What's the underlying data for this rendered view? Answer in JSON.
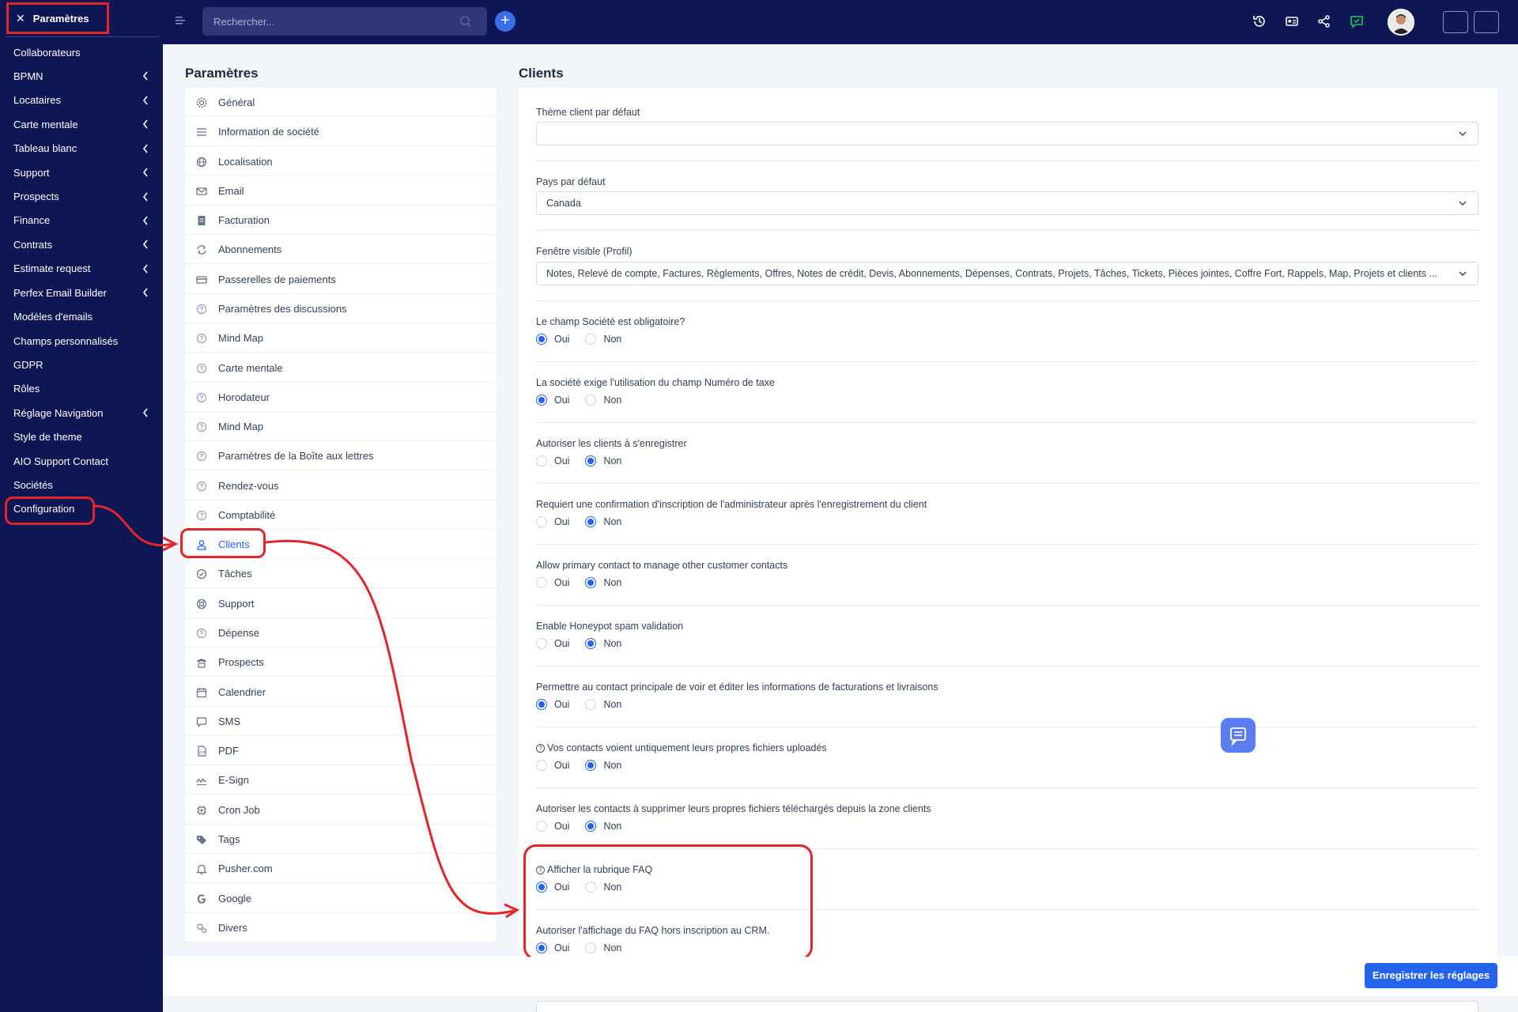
{
  "sidebar": {
    "header": "Paramètres",
    "items": [
      {
        "label": "Collaborateurs",
        "chevron": false
      },
      {
        "label": "BPMN",
        "chevron": true
      },
      {
        "label": "Locataires",
        "chevron": true
      },
      {
        "label": "Carte mentale",
        "chevron": true
      },
      {
        "label": "Tableau blanc",
        "chevron": true
      },
      {
        "label": "Support",
        "chevron": true
      },
      {
        "label": "Prospects",
        "chevron": true
      },
      {
        "label": "Finance",
        "chevron": true
      },
      {
        "label": "Contrats",
        "chevron": true
      },
      {
        "label": "Estimate request",
        "chevron": true
      },
      {
        "label": "Perfex Email Builder",
        "chevron": true
      },
      {
        "label": "Modèles d'emails",
        "chevron": false
      },
      {
        "label": "Champs personnalisés",
        "chevron": false
      },
      {
        "label": "GDPR",
        "chevron": false
      },
      {
        "label": "Rôles",
        "chevron": false
      },
      {
        "label": "Réglage Navigation",
        "chevron": true
      },
      {
        "label": "Style de theme",
        "chevron": false
      },
      {
        "label": "AIO Support Contact",
        "chevron": false
      },
      {
        "label": "Sociétés",
        "chevron": false
      },
      {
        "label": "Configuration",
        "chevron": false
      }
    ]
  },
  "topbar": {
    "search_placeholder": "Rechercher..."
  },
  "settings": {
    "title": "Paramètres",
    "items": [
      {
        "label": "Général",
        "icon": "gear-icon"
      },
      {
        "label": "Information de société",
        "icon": "lines-icon"
      },
      {
        "label": "Localisation",
        "icon": "globe-icon"
      },
      {
        "label": "Email",
        "icon": "envelope-icon"
      },
      {
        "label": "Facturation",
        "icon": "document-icon"
      },
      {
        "label": "Abonnements",
        "icon": "repeat-icon"
      },
      {
        "label": "Passerelles de paiements",
        "icon": "credit-card-icon"
      },
      {
        "label": "Paramètres des discussions",
        "icon": "help-circle-icon"
      },
      {
        "label": "Mind Map",
        "icon": "help-circle-icon"
      },
      {
        "label": "Carte mentale",
        "icon": "help-circle-icon"
      },
      {
        "label": "Horodateur",
        "icon": "help-circle-icon"
      },
      {
        "label": "Mind Map",
        "icon": "help-circle-icon"
      },
      {
        "label": "Paramètres de la Boîte aux lettres",
        "icon": "help-circle-icon"
      },
      {
        "label": "Rendez-vous",
        "icon": "help-circle-icon"
      },
      {
        "label": "Comptabilité",
        "icon": "help-circle-icon"
      },
      {
        "label": "Clients",
        "icon": "user-icon",
        "active": true
      },
      {
        "label": "Tâches",
        "icon": "check-circle-icon"
      },
      {
        "label": "Support",
        "icon": "lifebuoy-icon"
      },
      {
        "label": "Dépense",
        "icon": "help-circle-icon"
      },
      {
        "label": "Prospects",
        "icon": "phone-icon"
      },
      {
        "label": "Calendrier",
        "icon": "calendar-icon"
      },
      {
        "label": "SMS",
        "icon": "chat-icon"
      },
      {
        "label": "PDF",
        "icon": "pdf-icon"
      },
      {
        "label": "E-Sign",
        "icon": "signature-icon"
      },
      {
        "label": "Cron Job",
        "icon": "chip-icon"
      },
      {
        "label": "Tags",
        "icon": "tag-icon"
      },
      {
        "label": "Pusher.com",
        "icon": "bell-icon"
      },
      {
        "label": "Google",
        "icon": "google-icon"
      },
      {
        "label": "Divers",
        "icon": "gears-icon"
      }
    ]
  },
  "clients": {
    "title": "Clients",
    "theme_label": "Thème client par défaut",
    "theme_value": "",
    "country_label": "Pays par défaut",
    "country_value": "Canada",
    "visible_label": "Fenêtre visible (Profil)",
    "visible_value": "Notes, Relevé de compte, Factures, Règlements, Offres, Notes de crédit, Devis, Abonnements, Dépenses, Contrats, Projets, Tâches, Tickets, Pièces jointes, Coffre Fort, Rappels, Map, Projets et clients ...",
    "yes": "Oui",
    "no": "Non",
    "questions": [
      {
        "label": "Le champ Société est obligatoire?",
        "value": "oui",
        "help": false
      },
      {
        "label": "La société exige l'utilisation du champ Numéro de taxe",
        "value": "oui",
        "help": false
      },
      {
        "label": "Autoriser les clients à s'enregistrer",
        "value": "non",
        "help": false
      },
      {
        "label": "Requiert une confirmation d'inscription de l'administrateur après l'enregistrement du client",
        "value": "non",
        "help": false
      },
      {
        "label": "Allow primary contact to manage other customer contacts",
        "value": "non",
        "help": false
      },
      {
        "label": "Enable Honeypot spam validation",
        "value": "non",
        "help": false
      },
      {
        "label": "Permettre au contact principale de voir et éditer les informations de facturations et livraisons",
        "value": "oui",
        "help": false
      },
      {
        "label": "Vos contacts voient untiquement leurs propres fichiers uploadés",
        "value": "non",
        "help": true
      },
      {
        "label": "Autoriser les contacts à supprimer leurs propres fichiers téléchargés depuis la zone clients",
        "value": "non",
        "help": false
      },
      {
        "label": "Afficher la rubrique FAQ",
        "value": "oui",
        "help": true
      },
      {
        "label": "Autoriser l'affichage du FAQ hors inscription au CRM.",
        "value": "oui",
        "help": false
      }
    ],
    "save_label": "Enregistrer les réglages"
  },
  "colors": {
    "sidebar_bg": "#0f1654",
    "accent": "#2563eb",
    "annotation": "#e0262b"
  }
}
